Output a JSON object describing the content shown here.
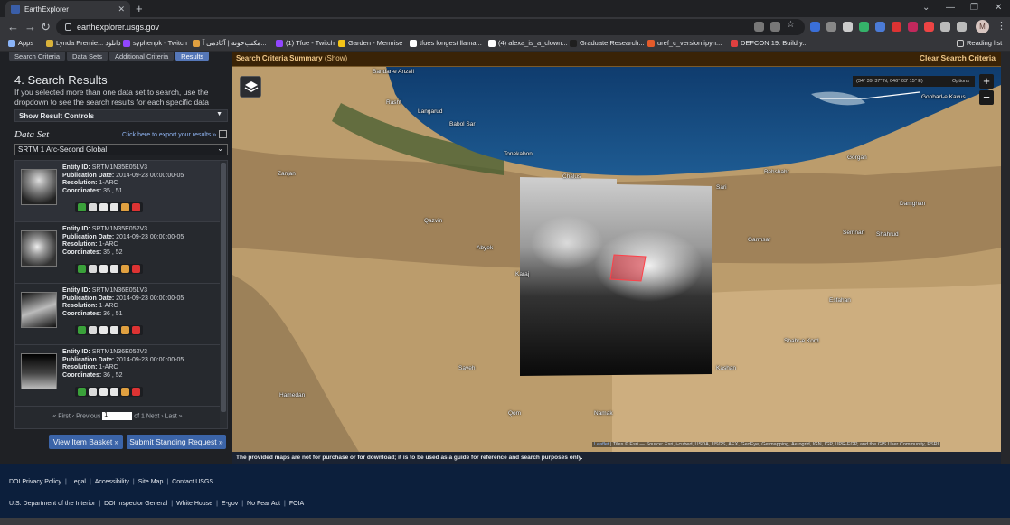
{
  "browser": {
    "tab_title": "EarthExplorer",
    "url": "earthexplorer.usgs.gov",
    "avatar_initial": "M",
    "bookmarks": [
      {
        "label": "Apps",
        "color": "#8ab4f8"
      },
      {
        "label": "Lynda Premie... دانلود",
        "color": "#d9b23a"
      },
      {
        "label": "syphenpk - Twitch",
        "color": "#9146ff"
      },
      {
        "label": "مکتب‌خونه | آکادمی آ...",
        "color": "#e0a040"
      },
      {
        "label": "(1) Tfue - Twitch",
        "color": "#9146ff"
      },
      {
        "label": "Garden - Memrise",
        "color": "#f5c518"
      },
      {
        "label": "tfues longest llama...",
        "color": "#ffffff"
      },
      {
        "label": "(4) alexa_is_a_clown...",
        "color": "#ffffff"
      },
      {
        "label": "Graduate Research...",
        "color": "#1f1f1f"
      },
      {
        "label": "uref_c_version.ipyn...",
        "color": "#e55b2a"
      },
      {
        "label": "DEFCON 19: Build y...",
        "color": "#e04040"
      }
    ],
    "reading_list": "Reading list"
  },
  "panel": {
    "tabs": [
      "Search Criteria",
      "Data Sets",
      "Additional Criteria",
      "Results"
    ],
    "active_tab": "Results",
    "title": "4. Search Results",
    "help": "If you selected more than one data set to search, use the dropdown to see the search results for each specific data set.",
    "show_result_controls": "Show Result Controls",
    "data_set_label": "Data Set",
    "export_link": "Click here to export your results »",
    "data_set_value": "SRTM 1 Arc-Second Global",
    "records": [
      {
        "entity": "SRTM1N35E051V3",
        "date": "2014-09-23 00:00:00-05",
        "resolution": "1-ARC",
        "coords": "35 , 51"
      },
      {
        "entity": "SRTM1N35E052V3",
        "date": "2014-09-23 00:00:00-05",
        "resolution": "1-ARC",
        "coords": "35 , 52"
      },
      {
        "entity": "SRTM1N36E051V3",
        "date": "2014-09-23 00:00:00-05",
        "resolution": "1-ARC",
        "coords": "36 , 51"
      },
      {
        "entity": "SRTM1N36E052V3",
        "date": "2014-09-23 00:00:00-05",
        "resolution": "1-ARC",
        "coords": "36 , 52"
      }
    ],
    "field_labels": {
      "entity": "Entity ID:",
      "date": "Publication Date:",
      "resolution": "Resolution:",
      "coords": "Coordinates:"
    },
    "pager": {
      "first": "« First",
      "previous": "‹ Previous",
      "page": "1",
      "of": "of 1",
      "next": "Next ›",
      "last": "Last »"
    },
    "view_basket": "View Item Basket »",
    "submit_standing": "Submit Standing Request »"
  },
  "map": {
    "header_title": "Search Criteria Summary",
    "header_show": "(Show)",
    "clear": "Clear Search Criteria",
    "coords": "(34° 39' 37\" N, 046° 03' 15\" E)",
    "options": "Options",
    "zoom_in": "+",
    "zoom_out": "−",
    "labels": [
      "Bandar-e Anzali",
      "Rasht",
      "Langarud",
      "Babol Sar",
      "Tonekabon",
      "Chalus",
      "Zanjan",
      "Qazvin",
      "Abyek",
      "Karaj",
      "Sari",
      "Behshahr",
      "Gorgan",
      "Gonbad-e Kavus",
      "Damghan",
      "Shahrud",
      "Semnan",
      "Garmsar",
      "Saveh",
      "Hamedan",
      "Qom",
      "Kashan",
      "Shahr-e Kord",
      "Esfahan",
      "Namak"
    ],
    "attribution_leaflet": "Leaflet",
    "attribution": "| Tiles © Esri — Source: Esri, i-cubed, USDA, USGS, AEX, GeoEye, Getmapping, Aerogrid, IGN, IGP, UPR-EGP, and the GIS User Community, ESRI",
    "note": "The provided maps are not for purchase or for download; it is to be used as a guide for reference and search purposes only."
  },
  "footer": {
    "row1": [
      "DOI Privacy Policy",
      "Legal",
      "Accessibility",
      "Site Map",
      "Contact USGS"
    ],
    "row2": [
      "U.S. Department of the Interior",
      "DOI Inspector General",
      "White House",
      "E-gov",
      "No Fear Act",
      "FOIA"
    ]
  }
}
